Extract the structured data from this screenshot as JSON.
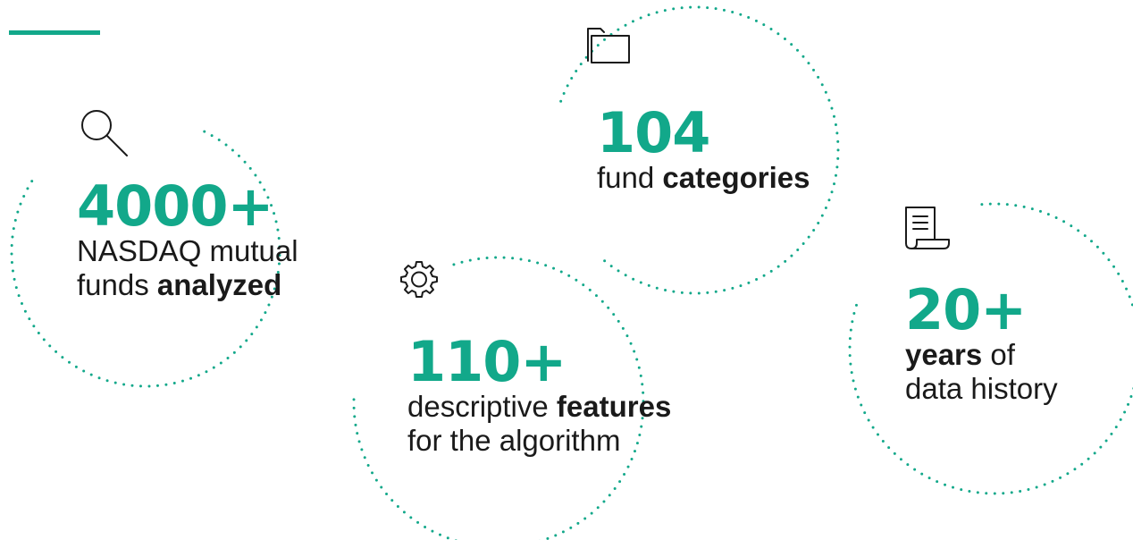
{
  "colors": {
    "accent": "#12a88a",
    "text": "#1a1a1a"
  },
  "stats": [
    {
      "icon": "search-icon",
      "number": "4000+",
      "lines": [
        {
          "pre": "NASDAQ mutual",
          "bold": "",
          "post": ""
        },
        {
          "pre": "funds ",
          "bold": "analyzed",
          "post": ""
        }
      ]
    },
    {
      "icon": "folder-icon",
      "number": "104",
      "lines": [
        {
          "pre": "fund ",
          "bold": "categories",
          "post": ""
        }
      ]
    },
    {
      "icon": "gear-icon",
      "number": "110+",
      "lines": [
        {
          "pre": "descriptive ",
          "bold": "features",
          "post": ""
        },
        {
          "pre": "for the algorithm",
          "bold": "",
          "post": ""
        }
      ]
    },
    {
      "icon": "document-icon",
      "number": "20+",
      "lines": [
        {
          "pre": "",
          "bold": "years",
          "post": " of"
        },
        {
          "pre": "data history",
          "bold": "",
          "post": ""
        }
      ]
    }
  ]
}
